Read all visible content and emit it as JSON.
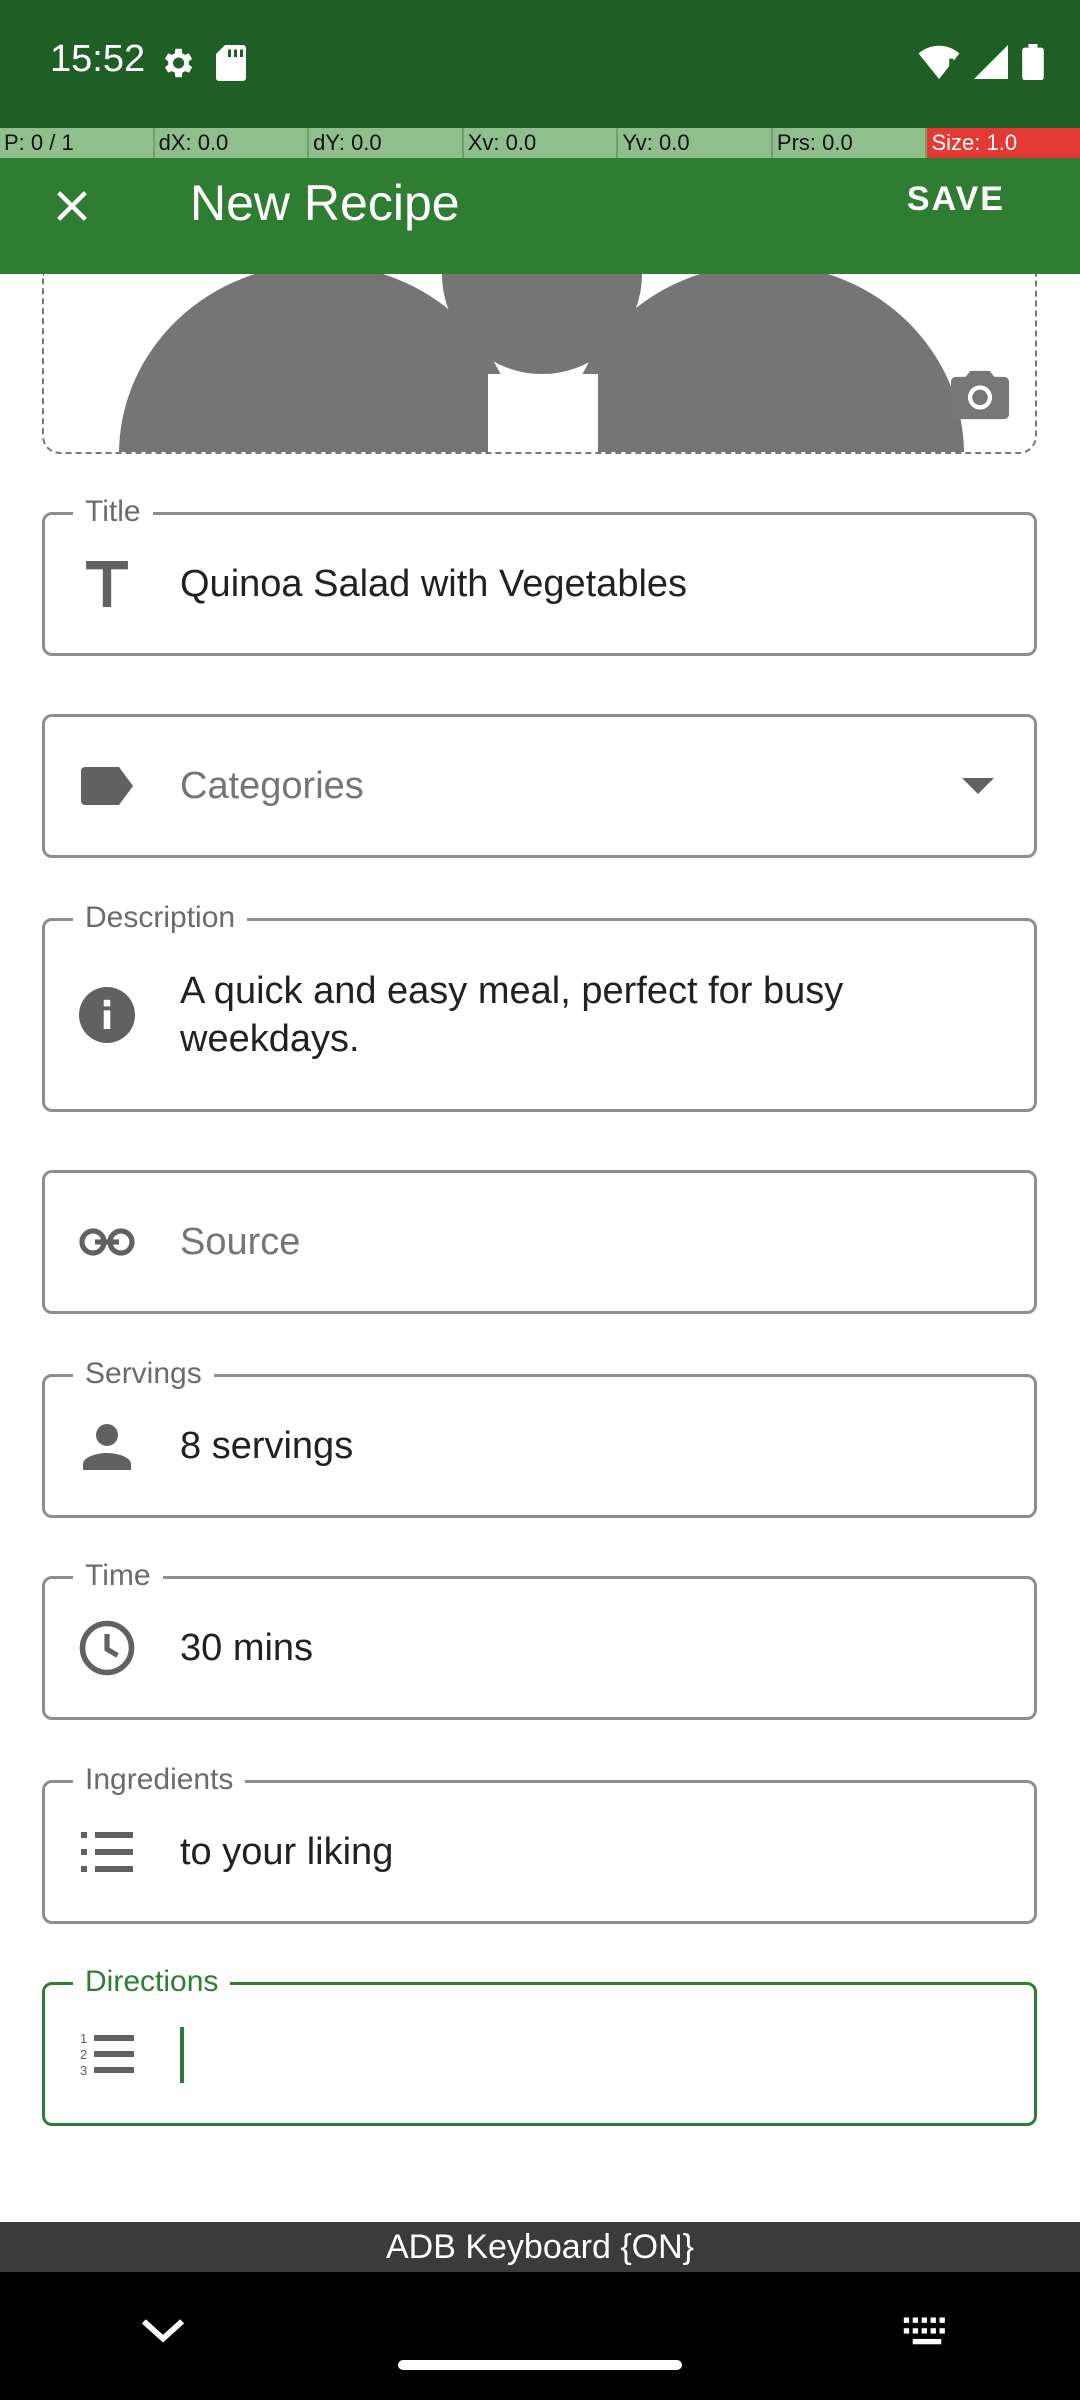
{
  "status_bar": {
    "time": "15:52"
  },
  "debug_bar": [
    "P: 0 / 1",
    "dX: 0.0",
    "dY: 0.0",
    "Xv: 0.0",
    "Yv: 0.0",
    "Prs: 0.0",
    "Size: 1.0"
  ],
  "app_bar": {
    "title": "New Recipe",
    "save_label": "SAVE"
  },
  "form": {
    "title": {
      "label": "Title",
      "value": "Quinoa Salad with Vegetables"
    },
    "categories": {
      "placeholder": "Categories"
    },
    "description": {
      "label": "Description",
      "value": "A quick and easy meal, perfect for busy weekdays."
    },
    "source": {
      "placeholder": "Source"
    },
    "servings": {
      "label": "Servings",
      "value": "8 servings"
    },
    "time": {
      "label": "Time",
      "value": "30 mins"
    },
    "ingredients": {
      "label": "Ingredients",
      "value": "to your liking"
    },
    "directions": {
      "label": "Directions",
      "value": ""
    }
  },
  "keyboard": {
    "label": "ADB Keyboard {ON}"
  },
  "colors": {
    "primary": "#2e7d32",
    "primary_dark": "#1f5e25"
  }
}
